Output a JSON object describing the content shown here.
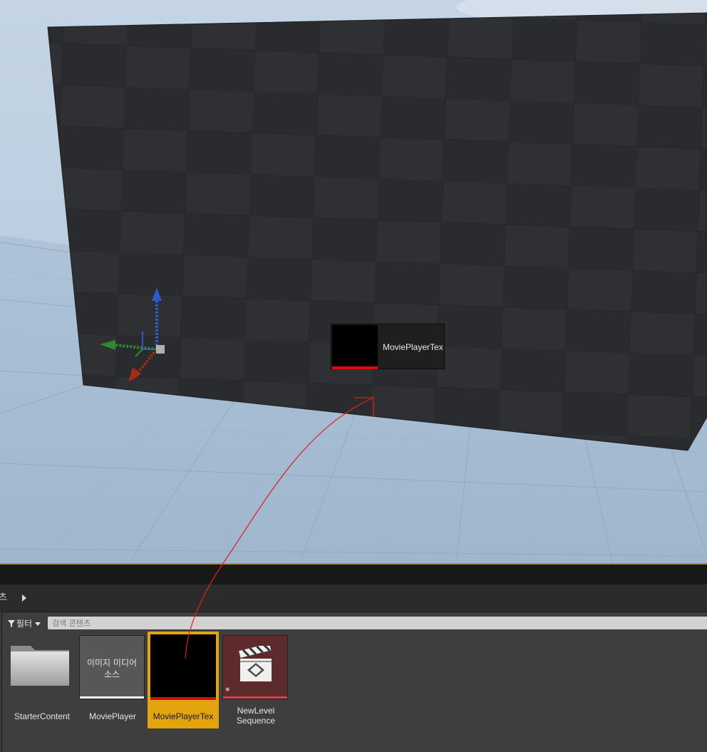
{
  "viewport": {
    "drag_tooltip": {
      "asset_name": "MoviePlayerTex"
    }
  },
  "content_browser": {
    "path": {
      "crumb": "츠"
    },
    "filter": {
      "label": "필터"
    },
    "search": {
      "placeholder": "검색 콘텐츠",
      "value": ""
    },
    "assets": [
      {
        "name": "StarterContent",
        "kind": "folder"
      },
      {
        "name": "MoviePlayer",
        "kind": "media-source",
        "thumbnail_text_line1": "이미지 미디어",
        "thumbnail_text_line2": "소스"
      },
      {
        "name": "MoviePlayerTex",
        "kind": "media-texture",
        "selected": true
      },
      {
        "name_line1": "NewLevel",
        "name_line2": "Sequence",
        "kind": "level-sequence",
        "unsaved_marker": "*"
      }
    ]
  },
  "colors": {
    "selection": "#e3a40f",
    "texture_bar": "#d40d0d",
    "drag_line": "#e01e1e",
    "sky": "#b7cbe0",
    "floor": "#a6bdd4",
    "wall": "#2d2e31"
  }
}
